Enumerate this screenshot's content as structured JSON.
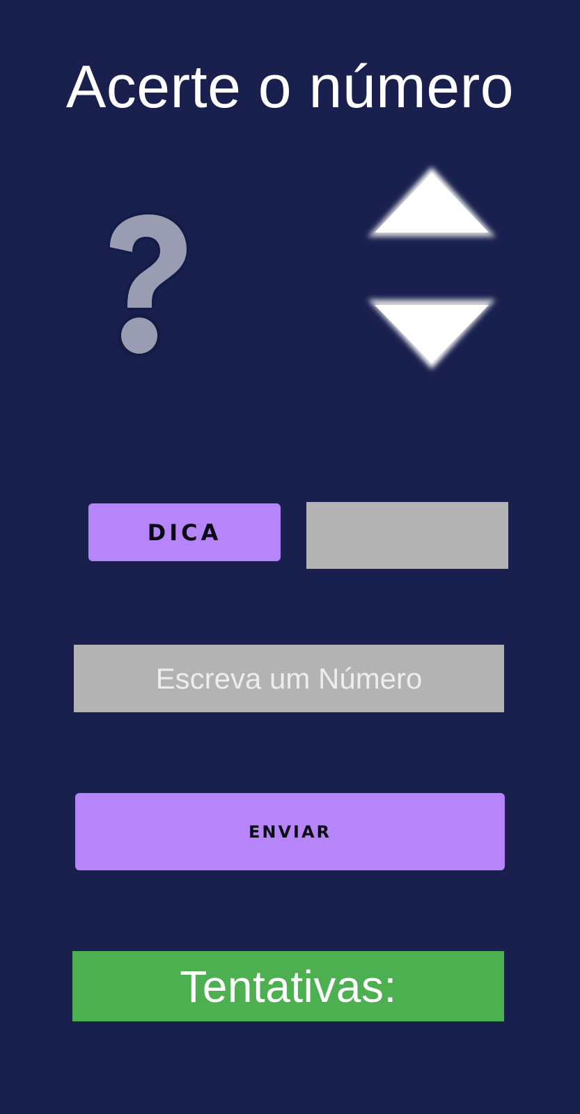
{
  "header": {
    "title": "Acerte o número"
  },
  "icons": {
    "question": "question-mark-icon",
    "higher": "arrow-up-icon",
    "lower": "arrow-down-icon"
  },
  "hint": {
    "button_label": "DICA",
    "output_text": ""
  },
  "guess": {
    "value": "",
    "placeholder": "Escreva um Número"
  },
  "send": {
    "button_label": "ENVIAR"
  },
  "attempts": {
    "label": "Tentativas:"
  },
  "colors": {
    "background": "#19204e",
    "button": "#b785fa",
    "field": "#b3b3b3",
    "attempts_bar": "#4caf50",
    "text_light": "#ffffff"
  }
}
